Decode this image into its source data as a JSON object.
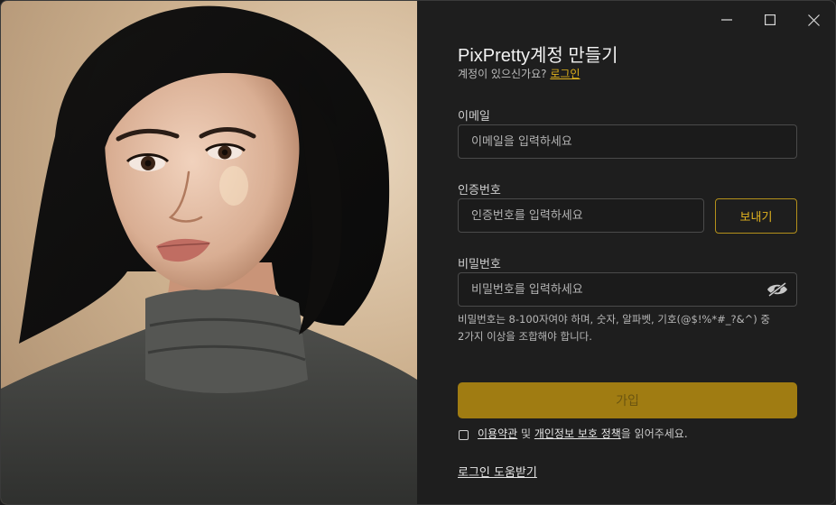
{
  "window": {
    "controls": [
      "minimize-icon",
      "maximize-icon",
      "close-icon"
    ]
  },
  "photo": {
    "alt": "portrait"
  },
  "signup": {
    "title": "PixPretty계정 만들기",
    "have_account_text": "계정이 있으신가요?",
    "login_link": "로그인",
    "email": {
      "label": "이메일",
      "placeholder": "이메일을 입력하세요",
      "value": ""
    },
    "code": {
      "label": "인증번호",
      "placeholder": "인증번호를 입력하세요",
      "value": "",
      "send_button": "보내기"
    },
    "password": {
      "label": "비밀번호",
      "placeholder": "비밀번호를 입력하세요",
      "value": "",
      "toggle_icon": "eye-slash-icon",
      "hint_line1": "비밀번호는 8-100자여야 하며, 숫자, 알파벳, 기호(@$!%*#_?&^) 중",
      "hint_line2": "2가지 이상을 조합해야 합니다."
    },
    "join_button": "가입",
    "agreement": {
      "terms_link": "이용약관",
      "and_text": " 및 ",
      "privacy_link": "개인정보 보호 정책",
      "suffix_text": "을 읽어주세요."
    },
    "help_link": "로그인 도움받기"
  },
  "colors": {
    "accent": "#e2b31e",
    "join_button_bg": "#a07c12",
    "panel_bg": "#1e1e1e"
  }
}
